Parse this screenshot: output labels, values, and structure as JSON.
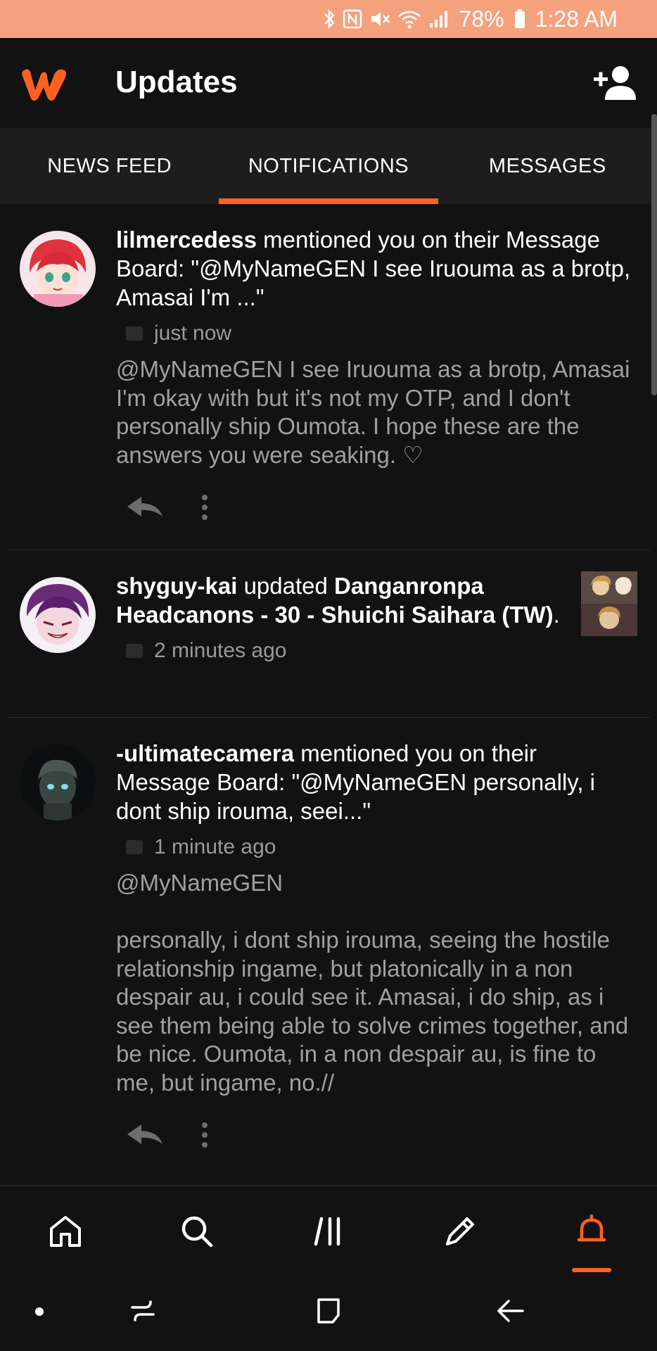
{
  "status_bar": {
    "battery": "78%",
    "time": "1:28 AM"
  },
  "header": {
    "title": "Updates"
  },
  "tabs": [
    {
      "label": "NEWS FEED",
      "active": false
    },
    {
      "label": "NOTIFICATIONS",
      "active": true
    },
    {
      "label": "MESSAGES",
      "active": false
    }
  ],
  "feed": [
    {
      "user": "lilmercedess",
      "action": " mentioned you on their Message Board: \"@MyNameGEN I see Iruouma as a brotp, Amasai I'm ...\"",
      "time": "just now",
      "body": "@MyNameGEN  I see Iruouma as a brotp, Amasai I'm okay with but it's not my OTP, and I don't personally ship Oumota. I hope these are the answers you were seaking. ♡"
    },
    {
      "user": "shyguy-kai",
      "action": " updated ",
      "story": "Danganronpa Headcanons - 30 - Shuichi Saihara (TW)",
      "suffix": ".",
      "time": "2 minutes ago"
    },
    {
      "user": "-ultimatecamera",
      "action": " mentioned you on their Message Board: \"@MyNameGEN personally, i dont ship irouma, seei...\"",
      "time": "1 minute ago",
      "body": "@MyNameGEN\n\npersonally, i dont ship irouma, seeing the hostile relationship ingame, but platonically in a non despair au, i could see it. Amasai, i do ship, as i see them being able to solve crimes together, and be nice. Oumota, in a non despair au, is fine to me, but ingame, no.//"
    }
  ],
  "bottom_nav": {
    "items": [
      "home-icon",
      "search-icon",
      "library-icon",
      "write-icon",
      "notifications-icon"
    ],
    "active": "notifications-icon"
  },
  "colors": {
    "accent": "#ff6122",
    "status_bar": "#f4a27e",
    "background": "#121212"
  }
}
